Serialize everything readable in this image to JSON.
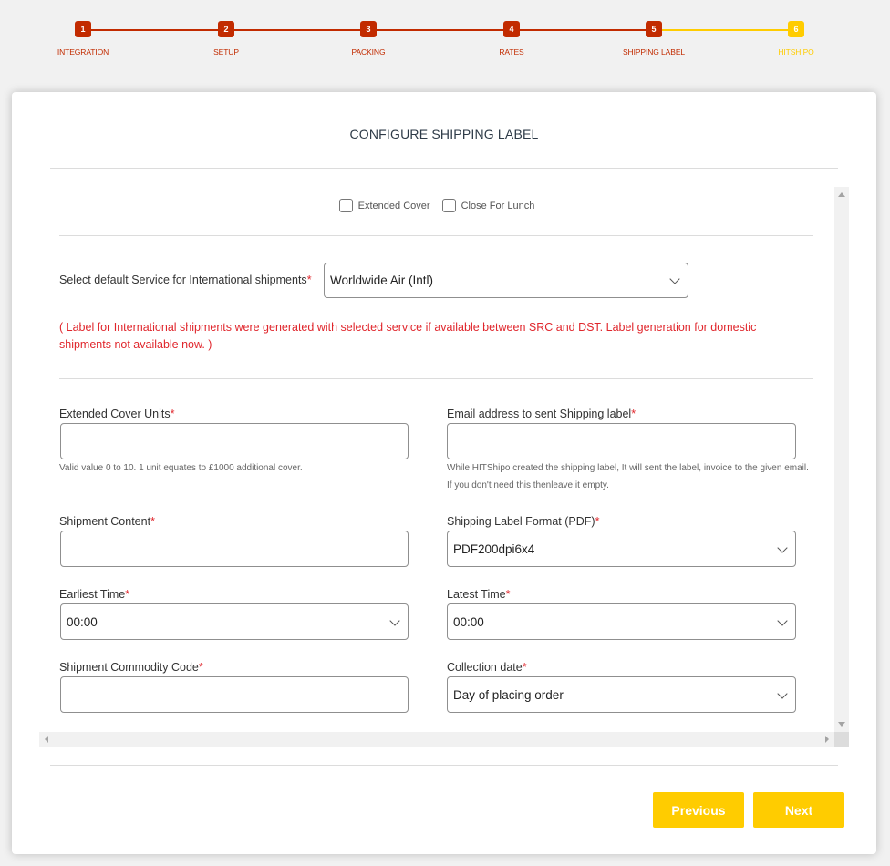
{
  "stepper": {
    "steps": [
      {
        "number": "1",
        "label": "INTEGRATION",
        "status": "completed"
      },
      {
        "number": "2",
        "label": "SETUP",
        "status": "completed"
      },
      {
        "number": "3",
        "label": "PACKING",
        "status": "completed"
      },
      {
        "number": "4",
        "label": "RATES",
        "status": "completed"
      },
      {
        "number": "5",
        "label": "SHIPPING LABEL",
        "status": "current"
      },
      {
        "number": "6",
        "label": "HITSHIPO",
        "status": "pending"
      }
    ],
    "colors": {
      "completed": "#c22b00",
      "pending": "#ffcc00"
    }
  },
  "card": {
    "title": "CONFIGURE SHIPPING LABEL"
  },
  "options": {
    "extended_cover": {
      "label": "Extended Cover",
      "checked": false
    },
    "close_for_lunch": {
      "label": "Close For Lunch",
      "checked": false
    }
  },
  "service": {
    "label": "Select default Service for International shipments",
    "required_mark": "*",
    "value": "Worldwide Air (Intl)",
    "note": "( Label for International shipments were generated with selected service if available between SRC and DST. Label generation for domestic shipments not available now. )"
  },
  "fields": {
    "extended_cover_units": {
      "label": "Extended Cover Units",
      "required_mark": "*",
      "value": "",
      "help": "Valid value 0 to 10. 1 unit equates to £1000 additional cover."
    },
    "email": {
      "label": "Email address to sent Shipping label",
      "required_mark": "*",
      "value": "",
      "help": "While HITShipo created the shipping label, It will sent the label, invoice to the given email. If you don't need this thenleave it empty."
    },
    "shipment_content": {
      "label": "Shipment Content",
      "required_mark": "*",
      "value": ""
    },
    "label_format": {
      "label": "Shipping Label Format (PDF)",
      "required_mark": "*",
      "value": "PDF200dpi6x4"
    },
    "earliest_time": {
      "label": "Earliest Time",
      "required_mark": "*",
      "value": "00:00"
    },
    "latest_time": {
      "label": "Latest Time",
      "required_mark": "*",
      "value": "00:00"
    },
    "commodity_code": {
      "label": "Shipment Commodity Code",
      "required_mark": "*",
      "value": ""
    },
    "collection_date": {
      "label": "Collection date",
      "required_mark": "*",
      "value": "Day of placing order"
    }
  },
  "buttons": {
    "previous": "Previous",
    "next": "Next"
  }
}
